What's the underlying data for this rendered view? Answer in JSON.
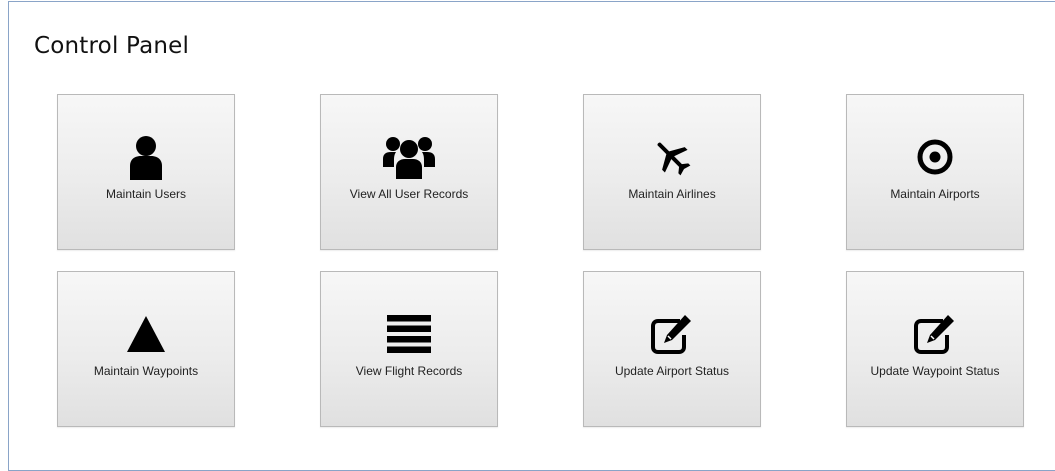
{
  "panel": {
    "title": "Control Panel"
  },
  "tiles": [
    {
      "label": "Maintain Users",
      "icon": "user-icon"
    },
    {
      "label": "View All User Records",
      "icon": "users-icon"
    },
    {
      "label": "Maintain Airlines",
      "icon": "plane-icon"
    },
    {
      "label": "Maintain Airports",
      "icon": "target-icon"
    },
    {
      "label": "Maintain Waypoints",
      "icon": "triangle-icon"
    },
    {
      "label": "View Flight Records",
      "icon": "list-icon"
    },
    {
      "label": "Update Airport Status",
      "icon": "edit-icon"
    },
    {
      "label": "Update Waypoint Status",
      "icon": "edit-icon"
    }
  ]
}
